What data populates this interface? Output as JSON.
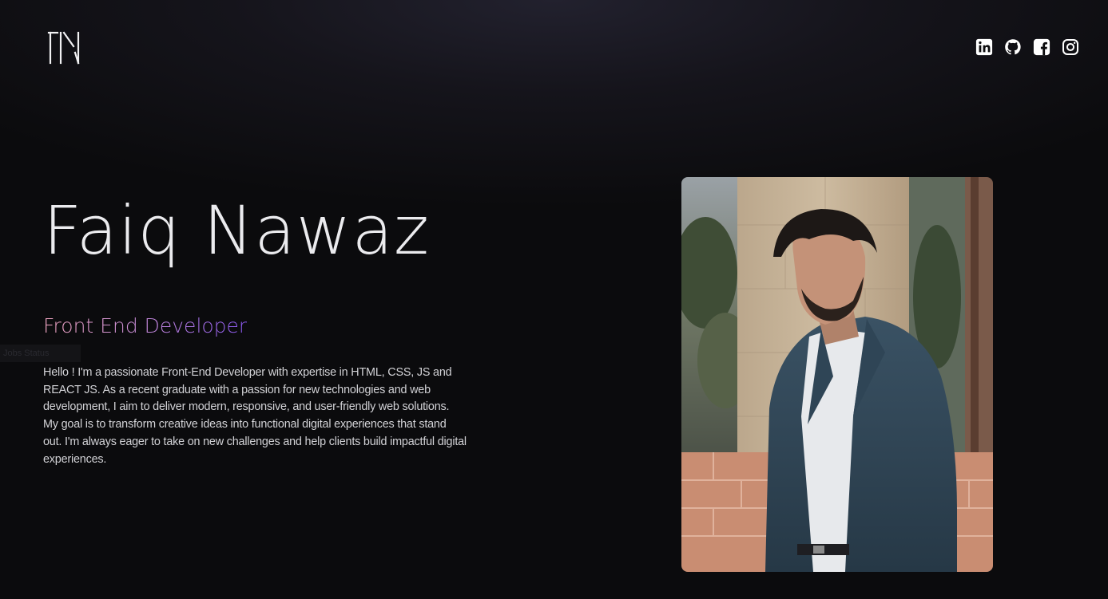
{
  "brand": {
    "logo_text": "FN"
  },
  "social": {
    "items": [
      {
        "name": "linkedin-icon",
        "label": "LinkedIn"
      },
      {
        "name": "github-icon",
        "label": "GitHub"
      },
      {
        "name": "facebook-icon",
        "label": "Facebook"
      },
      {
        "name": "instagram-icon",
        "label": "Instagram"
      }
    ]
  },
  "hero": {
    "name": "Faiq Nawaz",
    "role": "Front End Developer",
    "ghost_tab": "Jobs Status",
    "bio": "Hello ! I'm a passionate Front-End Developer with expertise in HTML, CSS, JS and REACT JS. As a recent graduate with a passion for new technologies and web development, I aim to deliver modern, responsive, and user-friendly web solutions. My goal is to transform creative ideas into functional digital experiences that stand out. I'm always eager to take on new challenges and help clients build impactful digital experiences."
  },
  "colors": {
    "background": "#0b0b0d",
    "text": "#ebebee",
    "role_gradient_start": "#f2a6c2",
    "role_gradient_end": "#8a58f0"
  }
}
